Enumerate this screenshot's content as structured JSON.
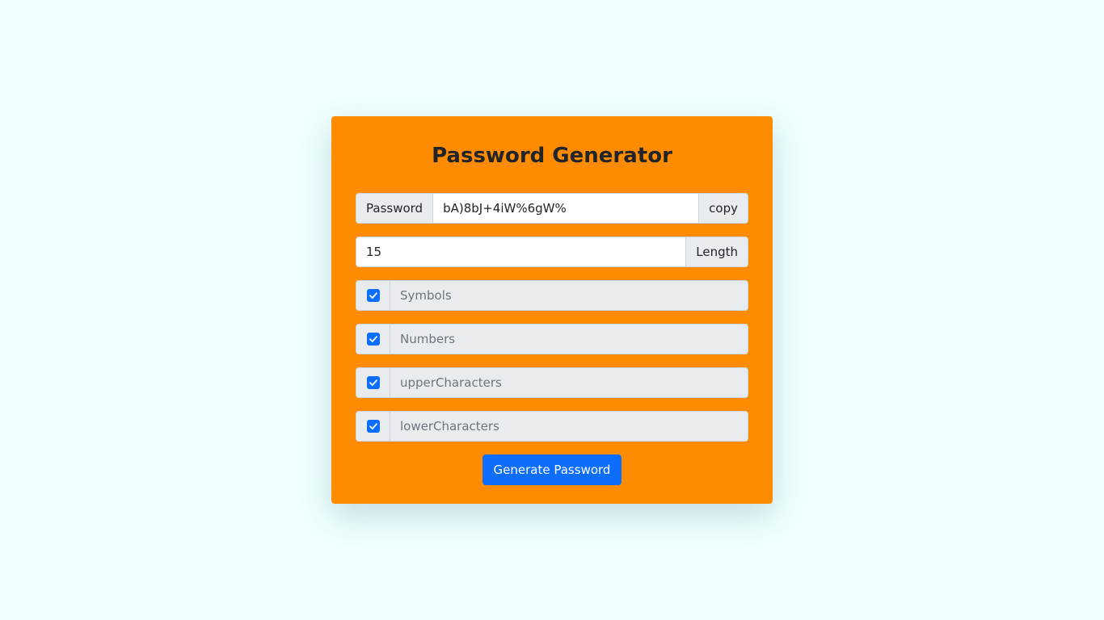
{
  "title": "Password Generator",
  "password": {
    "label": "Password",
    "value": "bA)8bJ+4iW%6gW%",
    "copy_label": "copy"
  },
  "length": {
    "value": "15",
    "label": "Length"
  },
  "options": [
    {
      "label": "Symbols",
      "checked": true
    },
    {
      "label": "Numbers",
      "checked": true
    },
    {
      "label": "upperCharacters",
      "checked": true
    },
    {
      "label": "lowerCharacters",
      "checked": true
    }
  ],
  "generate_label": "Generate Password",
  "colors": {
    "background": "#efffff",
    "card": "#ff8c00",
    "accent": "#0d6efd"
  }
}
